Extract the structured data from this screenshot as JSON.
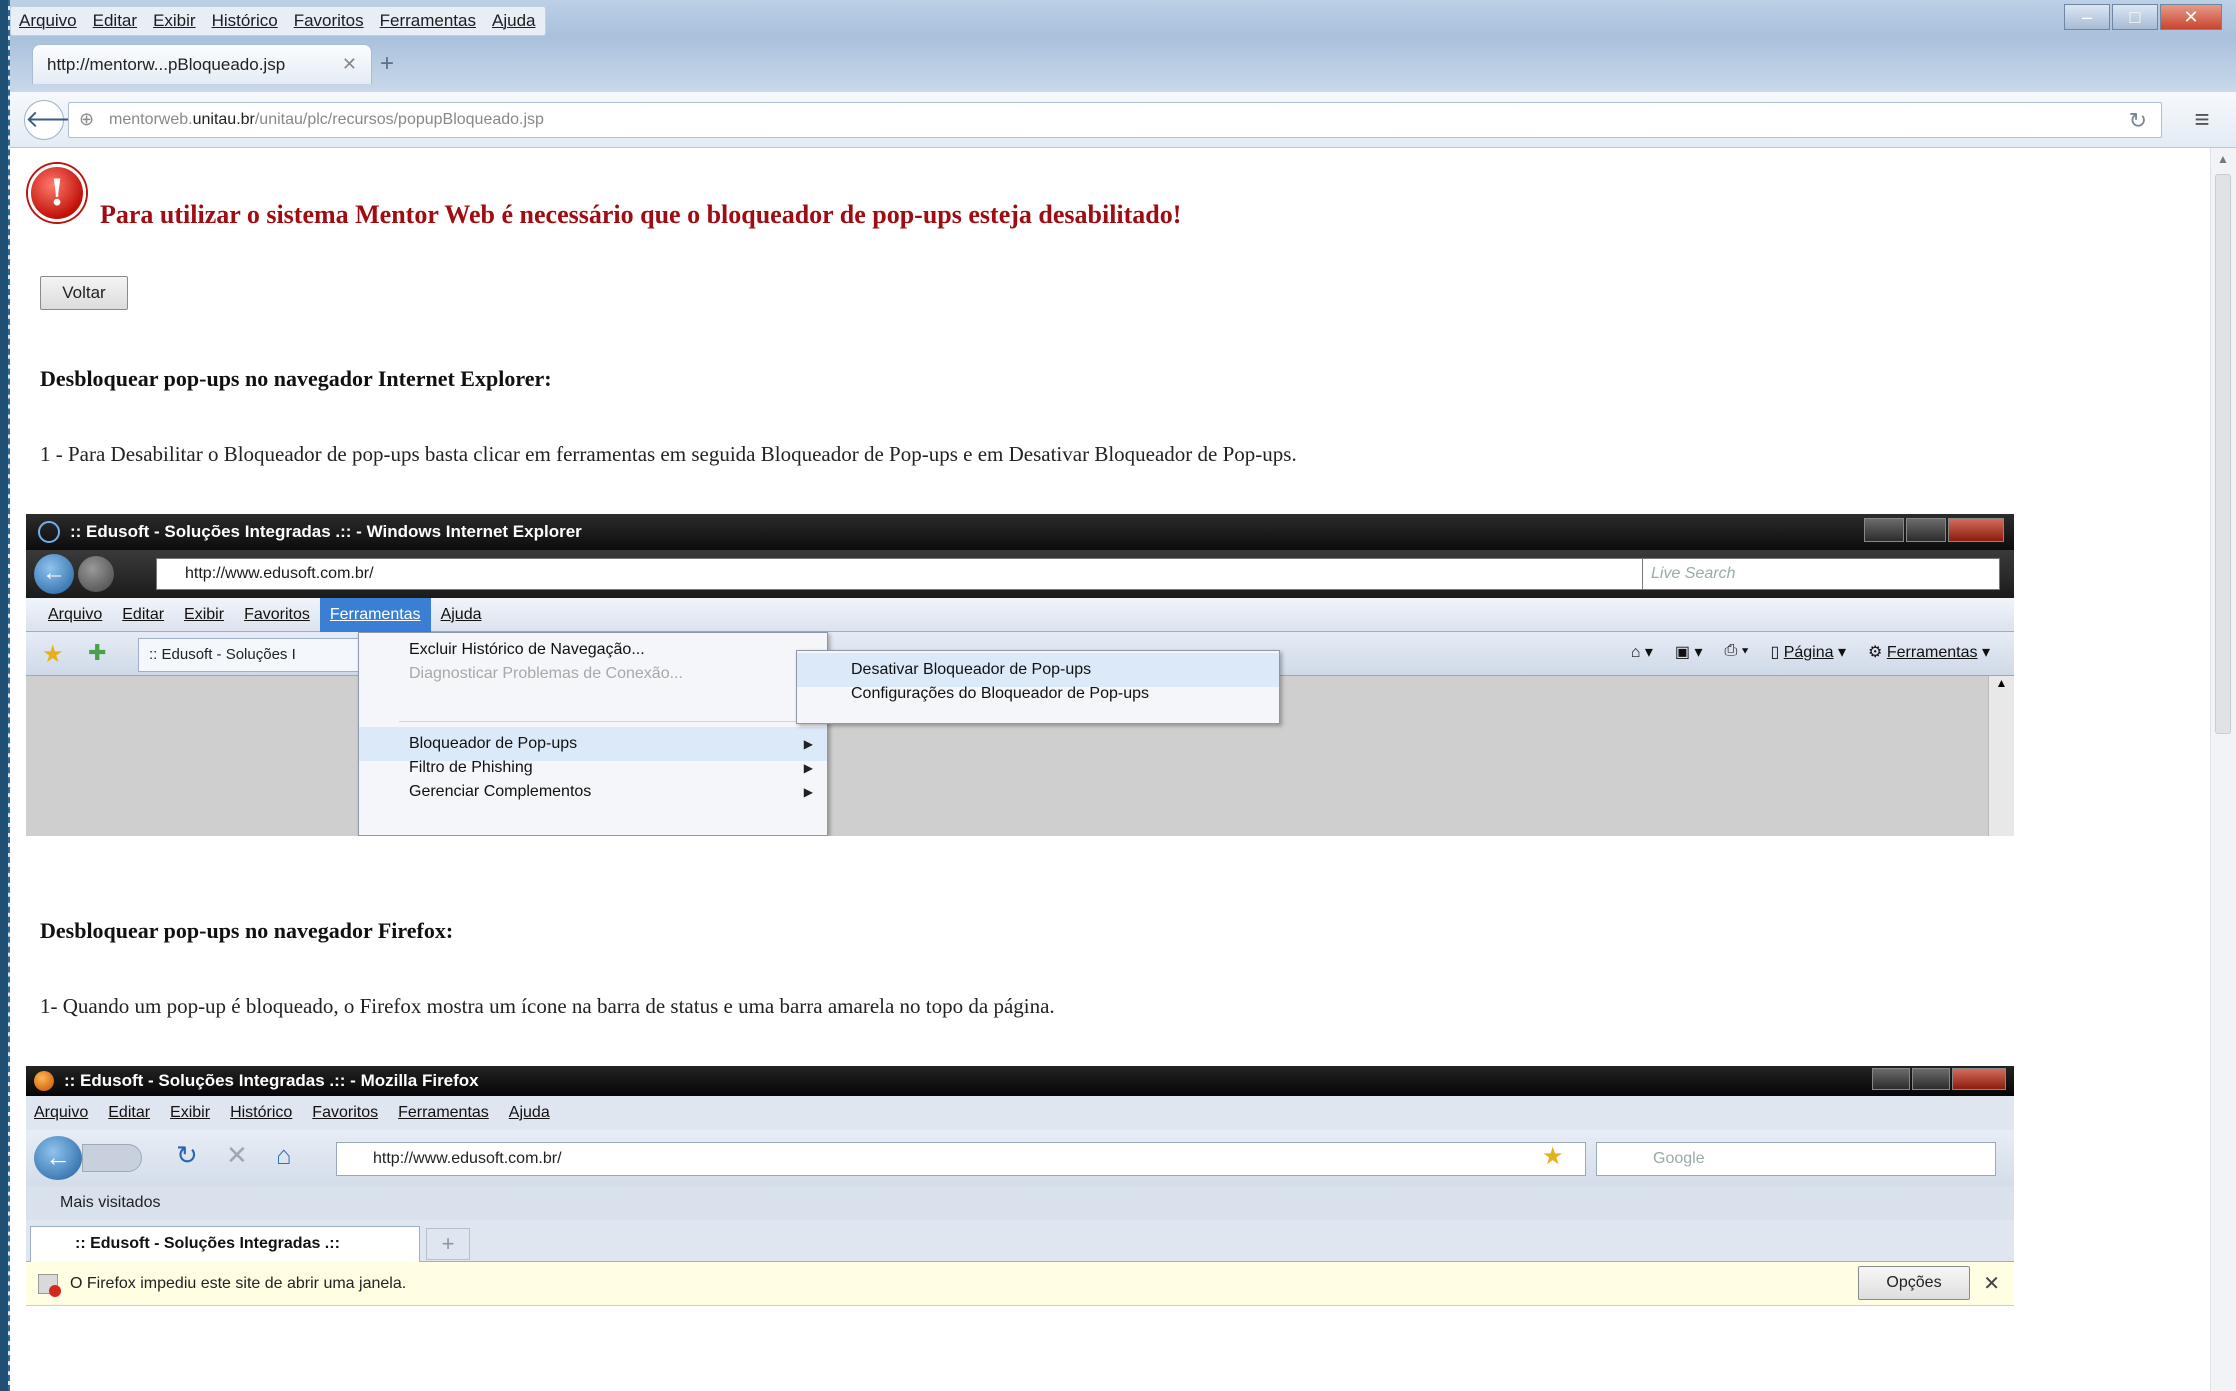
{
  "window": {
    "menu": [
      "Arquivo",
      "Editar",
      "Exibir",
      "Histórico",
      "Favoritos",
      "Ferramentas",
      "Ajuda"
    ],
    "tab_title": "http://mentorw...pBloqueado.jsp",
    "url_prefix": "mentorweb.",
    "url_domain": "unitau.br",
    "url_path": "/unitau/plc/recursos/popupBloqueado.jsp"
  },
  "page": {
    "warning_message": "Para utilizar o sistema Mentor Web é necessário que o bloqueador de pop-ups esteja desabilitado!",
    "back_button": "Voltar",
    "ie_heading": "Desbloquear pop-ups no navegador Internet Explorer:",
    "ie_step1": "1 - Para Desabilitar o Bloqueador de pop-ups basta clicar em ferramentas em seguida Bloqueador de Pop-ups e em Desativar Bloqueador de Pop-ups.",
    "ff_heading": "Desbloquear pop-ups no navegador Firefox:",
    "ff_step1": "1- Quando um pop-up é bloqueado, o Firefox mostra um ícone na barra de status e uma barra amarela no topo da página."
  },
  "ie_screenshot": {
    "title": ":: Edusoft - Soluções Integradas .:: - Windows Internet Explorer",
    "url": "http://www.edusoft.com.br/",
    "search_placeholder": "Live Search",
    "menu": [
      "Arquivo",
      "Editar",
      "Exibir",
      "Favoritos",
      "Ferramentas",
      "Ajuda"
    ],
    "active_menu": "Ferramentas",
    "tab": ":: Edusoft - Soluções I",
    "toolbar_pagina": "Página",
    "toolbar_ferramentas": "Ferramentas",
    "dropdown": {
      "item1": "Excluir Histórico de Navegação...",
      "item2": "Diagnosticar Problemas de Conexão...",
      "item3": "Bloqueador de Pop-ups",
      "item4": "Filtro de Phishing",
      "item5": "Gerenciar Complementos"
    },
    "submenu": {
      "item1": "Desativar Bloqueador de Pop-ups",
      "item2": "Configurações do Bloqueador de Pop-ups"
    }
  },
  "ff_screenshot": {
    "title": ":: Edusoft - Soluções Integradas .:: - Mozilla Firefox",
    "menu": [
      "Arquivo",
      "Editar",
      "Exibir",
      "Histórico",
      "Favoritos",
      "Ferramentas",
      "Ajuda"
    ],
    "url": "http://www.edusoft.com.br/",
    "search_placeholder": "Google",
    "bookmark": "Mais visitados",
    "tab": ":: Edusoft - Soluções Integradas .::",
    "notification": "O Firefox impediu este site de abrir uma janela.",
    "options_button": "Opções"
  }
}
